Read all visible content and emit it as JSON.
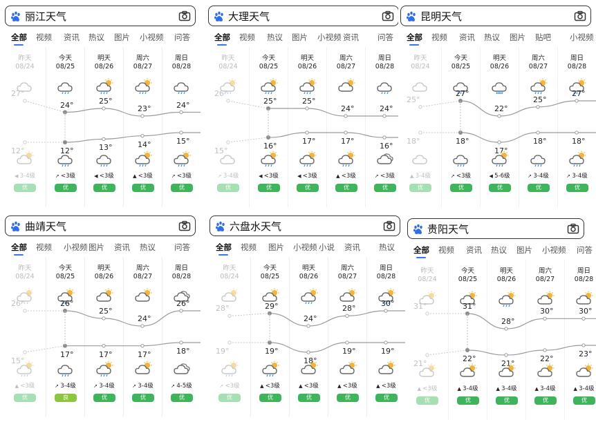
{
  "colors": {
    "accent": "#3a72f2",
    "good": "#3fb45b",
    "good_past": "#a7dfb4",
    "line": "#999999"
  },
  "panels": [
    {
      "query": "丽江天气",
      "tabs": [
        "全部",
        "视频",
        "资讯",
        "热议",
        "图片",
        "小视频",
        "问答"
      ],
      "days": [
        {
          "label": "昨天",
          "date": "08/24",
          "high": "27°",
          "low": "12°",
          "hi": 27,
          "lo": 12,
          "wind": "3-4级",
          "aq": "优",
          "icon": "cloudy-icon",
          "icon2": "partly-cloudy-icon",
          "dir": "up-left"
        },
        {
          "label": "今天",
          "date": "08/25",
          "high": "24°",
          "low": "12°",
          "hi": 24,
          "lo": 12,
          "wind": "<3级",
          "aq": "优",
          "icon": "rain-icon",
          "icon2": "rain-icon",
          "dir": "up-right"
        },
        {
          "label": "明天",
          "date": "08/26",
          "high": "25°",
          "low": "13°",
          "hi": 25,
          "lo": 13,
          "wind": "<3级",
          "aq": "优",
          "icon": "sun-rain-icon",
          "icon2": "rain-icon",
          "dir": "left"
        },
        {
          "label": "周六",
          "date": "08/27",
          "high": "23°",
          "low": "14°",
          "hi": 23,
          "lo": 14,
          "wind": "<3级",
          "aq": "优",
          "icon": "sun-rain-icon",
          "icon2": "sun-rain-icon",
          "dir": "up"
        },
        {
          "label": "周日",
          "date": "08/28",
          "high": "24°",
          "low": "15°",
          "hi": 24,
          "lo": 15,
          "wind": "<3级",
          "aq": "优",
          "icon": "rain-icon",
          "icon2": "sun-rain-icon",
          "dir": "up-right"
        }
      ]
    },
    {
      "query": "大理天气",
      "tabs": [
        "全部",
        "视频",
        "热议",
        "图片",
        "小视频",
        "资讯",
        "问答"
      ],
      "days": [
        {
          "label": "昨天",
          "date": "08/24",
          "high": "26°",
          "low": "15°",
          "hi": 26,
          "lo": 15,
          "wind": "3-4级",
          "aq": "优",
          "icon": "sun-rain-icon",
          "icon2": "cloudy-icon",
          "dir": "up-right"
        },
        {
          "label": "今天",
          "date": "08/25",
          "high": "25°",
          "low": "16°",
          "hi": 25,
          "lo": 16,
          "wind": "<3级",
          "aq": "优",
          "icon": "sun-rain-icon",
          "icon2": "sun-rain-icon",
          "dir": "left"
        },
        {
          "label": "明天",
          "date": "08/26",
          "high": "25°",
          "low": "17°",
          "hi": 25,
          "lo": 17,
          "wind": "<3级",
          "aq": "优",
          "icon": "sun-rain-icon",
          "icon2": "sun-rain-icon",
          "dir": "left"
        },
        {
          "label": "周六",
          "date": "08/27",
          "high": "24°",
          "low": "17°",
          "hi": 24,
          "lo": 17,
          "wind": "<3级",
          "aq": "优",
          "icon": "partly-cloudy-icon",
          "icon2": "sun-rain-icon",
          "dir": "up"
        },
        {
          "label": "周日",
          "date": "08/28",
          "high": "24°",
          "low": "16°",
          "hi": 24,
          "lo": 16,
          "wind": "<3级",
          "aq": "优",
          "icon": "rain-icon",
          "icon2": "overcast-icon",
          "dir": "up-right"
        }
      ]
    },
    {
      "query": "昆明天气",
      "tabs": [
        "全部",
        "视频",
        "资讯",
        "热议",
        "图片",
        "贴吧",
        "小视频"
      ],
      "days": [
        {
          "label": "昨天",
          "date": "08/24",
          "high": "25°",
          "low": "18°",
          "hi": 25,
          "lo": 18,
          "wind": "3-4级",
          "aq": "优",
          "icon": "cloudy-icon",
          "icon2": "cloudy-icon",
          "dir": "up"
        },
        {
          "label": "今天",
          "date": "08/25",
          "high": "27°",
          "low": "18°",
          "hi": 27,
          "lo": 18,
          "wind": "<3级",
          "aq": "优",
          "icon": "rain-icon",
          "icon2": "rain-icon",
          "dir": "up-right"
        },
        {
          "label": "明天",
          "date": "08/26",
          "high": "22°",
          "low": "17°",
          "hi": 22,
          "lo": 17,
          "wind": "5-6级",
          "aq": "优",
          "icon": "heavy-rain-icon",
          "icon2": "sun-rain-icon",
          "dir": "left"
        },
        {
          "label": "周六",
          "date": "08/27",
          "high": "25°",
          "low": "18°",
          "hi": 25,
          "lo": 18,
          "wind": "3-4级",
          "aq": "优",
          "icon": "sun-rain-icon",
          "icon2": "rain-icon",
          "dir": "up-right"
        },
        {
          "label": "周日",
          "date": "08/28",
          "high": "27°",
          "low": "18°",
          "hi": 27,
          "lo": 18,
          "wind": "3-4级",
          "aq": "优",
          "icon": "sun-rain-icon",
          "icon2": "sun-rain-icon",
          "dir": "up-right"
        }
      ]
    },
    {
      "query": "曲靖天气",
      "tabs": [
        "全部",
        "视频",
        "小视频",
        "图片",
        "资讯",
        "热议",
        "问答"
      ],
      "days": [
        {
          "label": "昨天",
          "date": "08/24",
          "high": "26°",
          "low": "15°",
          "hi": 26,
          "lo": 15,
          "wind": "<3级",
          "aq": "优",
          "icon": "sun-rain-icon",
          "icon2": "sun-rain-icon",
          "dir": "up"
        },
        {
          "label": "今天",
          "date": "08/25",
          "high": "26°",
          "low": "17°",
          "hi": 26,
          "lo": 17,
          "wind": "3-4级",
          "aq": "良",
          "icon": "sun-rain-icon",
          "icon2": "rain-icon",
          "dir": "up-right"
        },
        {
          "label": "明天",
          "date": "08/26",
          "high": "25°",
          "low": "17°",
          "hi": 25,
          "lo": 17,
          "wind": "3-4级",
          "aq": "优",
          "icon": "partly-cloudy-icon",
          "icon2": "sun-rain-icon",
          "dir": "up-right"
        },
        {
          "label": "周六",
          "date": "08/27",
          "high": "24°",
          "low": "17°",
          "hi": 24,
          "lo": 17,
          "wind": "3-4级",
          "aq": "优",
          "icon": "partly-cloudy-icon",
          "icon2": "partly-cloudy-icon",
          "dir": "up-right"
        },
        {
          "label": "周日",
          "date": "08/28",
          "high": "26°",
          "low": "18°",
          "hi": 26,
          "lo": 18,
          "wind": "4-5级",
          "aq": "优",
          "icon": "overcast-icon",
          "icon2": "overcast-icon",
          "dir": "up-right"
        }
      ]
    },
    {
      "query": "六盘水天气",
      "tabs": [
        "全部",
        "视频",
        "图片",
        "小视频",
        "小说",
        "资讯",
        "热议"
      ],
      "days": [
        {
          "label": "昨天",
          "date": "08/24",
          "high": "28°",
          "low": "19°",
          "hi": 28,
          "lo": 19,
          "wind": "<3级",
          "aq": "优",
          "icon": "partly-cloudy-icon",
          "icon2": "sun-rain-icon",
          "dir": "up-right"
        },
        {
          "label": "今天",
          "date": "08/25",
          "high": "29°",
          "low": "19°",
          "hi": 29,
          "lo": 19,
          "wind": "<3级",
          "aq": "优",
          "icon": "partly-cloudy-icon",
          "icon2": "sun-rain-icon",
          "dir": "up"
        },
        {
          "label": "明天",
          "date": "08/26",
          "high": "24°",
          "low": "18°",
          "hi": 24,
          "lo": 18,
          "wind": "<3级",
          "aq": "优",
          "icon": "sun-rain-icon",
          "icon2": "partly-cloudy-icon",
          "dir": "up"
        },
        {
          "label": "周六",
          "date": "08/27",
          "high": "28°",
          "low": "19°",
          "hi": 28,
          "lo": 19,
          "wind": "<3级",
          "aq": "优",
          "icon": "partly-cloudy-icon",
          "icon2": "partly-cloudy-icon",
          "dir": "up"
        },
        {
          "label": "周日",
          "date": "08/28",
          "high": "30°",
          "low": "19°",
          "hi": 30,
          "lo": 19,
          "wind": "<3级",
          "aq": "优",
          "icon": "sun-rain-icon",
          "icon2": "partly-cloudy-icon",
          "dir": "up"
        }
      ]
    },
    {
      "query": "贵阳天气",
      "tabs": [
        "全部",
        "视频",
        "资讯",
        "热议",
        "图片",
        "小视频",
        "问答"
      ],
      "days": [
        {
          "label": "昨天",
          "date": "08/24",
          "high": "31°",
          "low": "21°",
          "hi": 31,
          "lo": 21,
          "wind": "<3级",
          "aq": "优",
          "icon": "partly-cloudy-icon",
          "icon2": "partly-cloudy-icon",
          "dir": "up"
        },
        {
          "label": "今天",
          "date": "08/25",
          "high": "31°",
          "low": "22°",
          "hi": 31,
          "lo": 22,
          "wind": "3-4级",
          "aq": "优",
          "icon": "partly-cloudy-icon",
          "icon2": "partly-cloudy-icon",
          "dir": "up"
        },
        {
          "label": "明天",
          "date": "08/26",
          "high": "28°",
          "low": "21°",
          "hi": 28,
          "lo": 21,
          "wind": "3-4级",
          "aq": "优",
          "icon": "sun-rain-icon",
          "icon2": "partly-cloudy-icon",
          "dir": "up"
        },
        {
          "label": "周六",
          "date": "08/27",
          "high": "30°",
          "low": "22°",
          "hi": 30,
          "lo": 22,
          "wind": "3-4级",
          "aq": "优",
          "icon": "partly-cloudy-icon",
          "icon2": "partly-cloudy-icon",
          "dir": "up"
        },
        {
          "label": "周日",
          "date": "08/28",
          "high": "30°",
          "low": "23°",
          "hi": 30,
          "lo": 23,
          "wind": "3-4级",
          "aq": "优",
          "icon": "partly-cloudy-icon",
          "icon2": "partly-cloudy-icon",
          "dir": "up"
        }
      ]
    }
  ]
}
